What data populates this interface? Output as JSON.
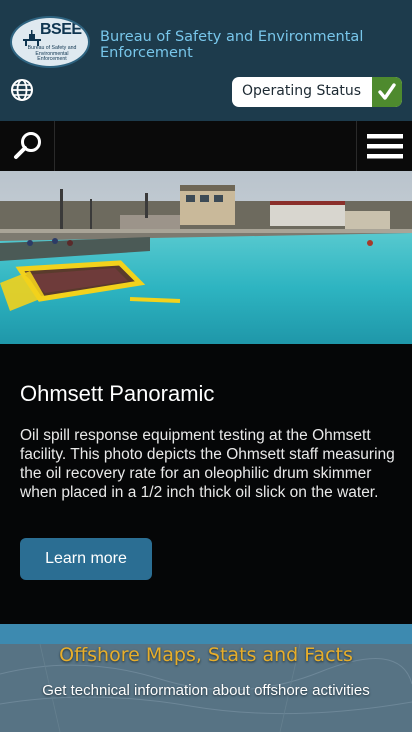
{
  "header": {
    "logo_text": "BSEE",
    "logo_subtext": "Bureau of Safety and Environmental Enforcement",
    "agency_name": "Bureau of Safety and Environmental Enforcement",
    "language_icon": "globe-icon",
    "operating_status_label": "Operating Status",
    "operating_status_icon": "checkmark-icon"
  },
  "navbar": {
    "search_icon": "search-icon",
    "menu_icon": "hamburger-menu-icon"
  },
  "feature": {
    "title": "Ohmsett Panoramic",
    "description": "Oil spill response equipment testing at the Ohmsett facility. This photo depicts the Ohmsett staff measuring the oil recovery rate for an oleophilic drum skimmer when placed in a 1/2 inch thick oil slick on the water.",
    "button_label": "Learn more"
  },
  "maps_banner": {
    "title": "Offshore Maps, Stats and Facts",
    "subtitle": "Get technical information about offshore activities"
  },
  "colors": {
    "header_bg": "#1d3b4c",
    "agency_text": "#78c6ea",
    "status_check_bg": "#4e8a2e",
    "learn_button_bg": "#2b6e93",
    "maps_title": "#e8ae2a"
  }
}
